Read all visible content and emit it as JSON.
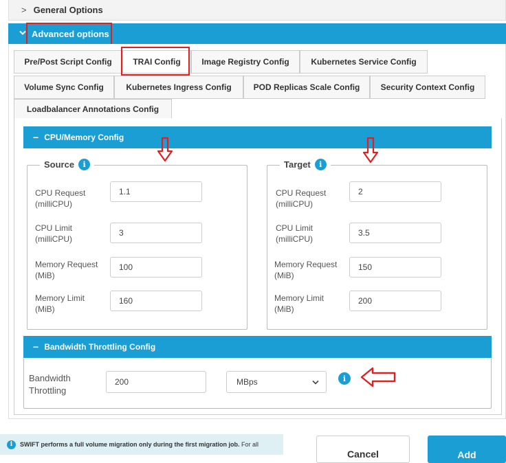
{
  "general_options": {
    "label": "General Options"
  },
  "advanced_options": {
    "label": "Advanced options"
  },
  "tabs": [
    {
      "label": "Pre/Post Script Config"
    },
    {
      "label": "TRAI Config"
    },
    {
      "label": "Image Registry Config"
    },
    {
      "label": "Kubernetes Service Config"
    },
    {
      "label": "Volume Sync Config"
    },
    {
      "label": "Kubernetes Ingress Config"
    },
    {
      "label": "POD Replicas Scale Config"
    },
    {
      "label": "Security Context Config"
    },
    {
      "label": "Loadbalancer Annotations Config"
    }
  ],
  "cpu_memory": {
    "title": "CPU/Memory Config",
    "source": {
      "legend": "Source",
      "cpu_request_label": "CPU Request (milliCPU)",
      "cpu_request": "1.1",
      "cpu_limit_label": "CPU Limit (milliCPU)",
      "cpu_limit": "3",
      "memory_request_label": "Memory Request (MiB)",
      "memory_request": "100",
      "memory_limit_label": "Memory Limit (MiB)",
      "memory_limit": "160"
    },
    "target": {
      "legend": "Target",
      "cpu_request_label": "CPU Request (milliCPU)",
      "cpu_request": "2",
      "cpu_limit_label": "CPU Limit (milliCPU)",
      "cpu_limit": "3.5",
      "memory_request_label": "Memory Request (MiB)",
      "memory_request": "150",
      "memory_limit_label": "Memory Limit (MiB)",
      "memory_limit": "200"
    }
  },
  "bandwidth": {
    "title": "Bandwidth Throttling Config",
    "label": "Bandwidth Throttling",
    "value": "200",
    "unit": "MBps"
  },
  "footer": {
    "notice_bold": "SWIFT performs a full volume migration only during the first migration job.",
    "notice_rest": "For all",
    "cancel_label": "Cancel",
    "add_label": "Add"
  },
  "icons": {
    "info": "i",
    "chevron_right": ">",
    "chevron_down": "v",
    "minus": "−",
    "select_chevron": "⌄"
  },
  "colors": {
    "accent": "#1a9ed4",
    "highlight": "#e02020"
  }
}
